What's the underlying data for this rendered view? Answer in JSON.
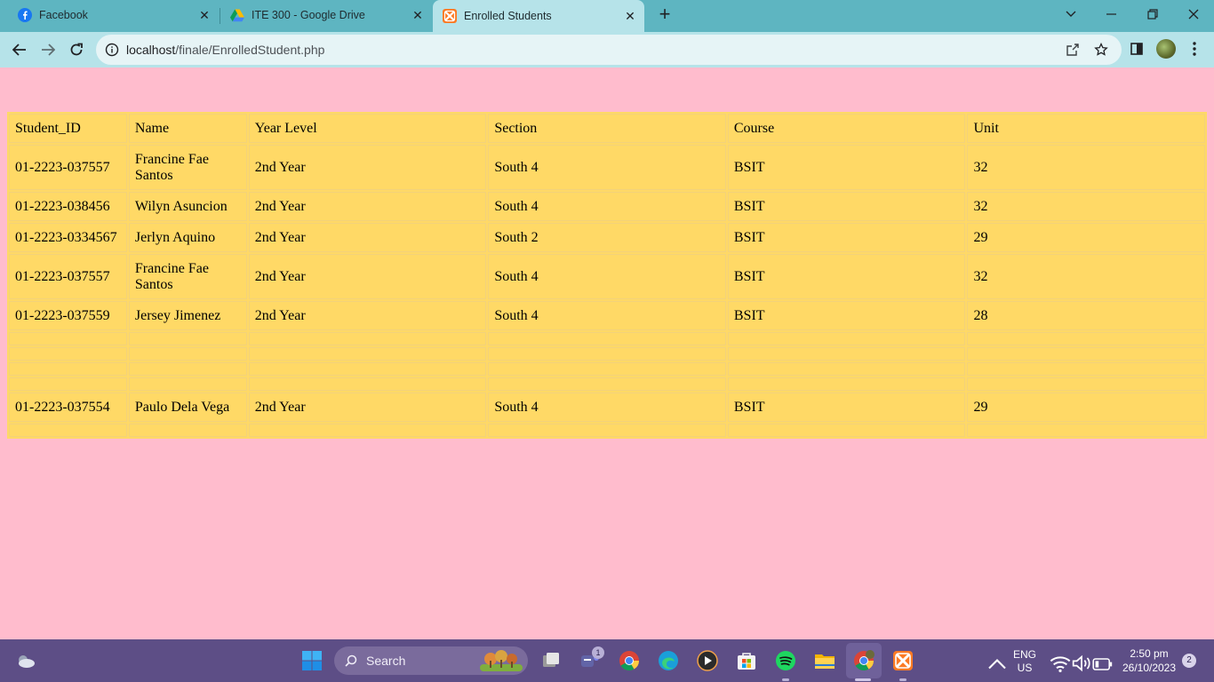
{
  "browser": {
    "tabs": [
      {
        "title": "Facebook"
      },
      {
        "title": "ITE 300 - Google Drive"
      },
      {
        "title": "Enrolled Students"
      }
    ],
    "url": {
      "host": "localhost",
      "path": "/finale/EnrolledStudent.php"
    }
  },
  "table": {
    "headers": [
      "Student_ID",
      "Name",
      "Year Level",
      "Section",
      "Course",
      "Unit"
    ],
    "rows": [
      {
        "id": "01-2223-037557",
        "name_l1": "Francine Fae",
        "name_l2": "Santos",
        "year": "2nd Year",
        "section": "South 4",
        "course": "BSIT",
        "unit": "32"
      },
      {
        "id": "01-2223-038456",
        "name_l1": "Wilyn Asuncion",
        "year": "2nd Year",
        "section": "South 4",
        "course": "BSIT",
        "unit": "32"
      },
      {
        "id": "01-2223-0334567",
        "name_l1": "Jerlyn Aquino",
        "year": "2nd Year",
        "section": "South 2",
        "course": "BSIT",
        "unit": "29"
      },
      {
        "id": "01-2223-037557",
        "name_l1": "Francine Fae",
        "name_l2": "Santos",
        "year": "2nd Year",
        "section": "South 4",
        "course": "BSIT",
        "unit": "32"
      },
      {
        "id": "01-2223-037559",
        "name_l1": "Jersey Jimenez",
        "year": "2nd Year",
        "section": "South 4",
        "course": "BSIT",
        "unit": "28"
      },
      {
        "id": "01-2223-037554",
        "name_l1": "Paulo Dela Vega",
        "year": "2nd Year",
        "section": "South 4",
        "course": "BSIT",
        "unit": "29"
      }
    ]
  },
  "taskbar": {
    "search_label": "Search",
    "teams_badge": "1",
    "lang_top": "ENG",
    "lang_bottom": "US",
    "time": "2:50 pm",
    "date": "26/10/2023",
    "notif_count": "2"
  },
  "colors": {
    "page_bg": "#ffbccd",
    "table_bg": "#ffd966",
    "tabstrip": "#5eb5c1",
    "toolbar": "#b6e3e9",
    "taskbar": "#5d4e86"
  }
}
